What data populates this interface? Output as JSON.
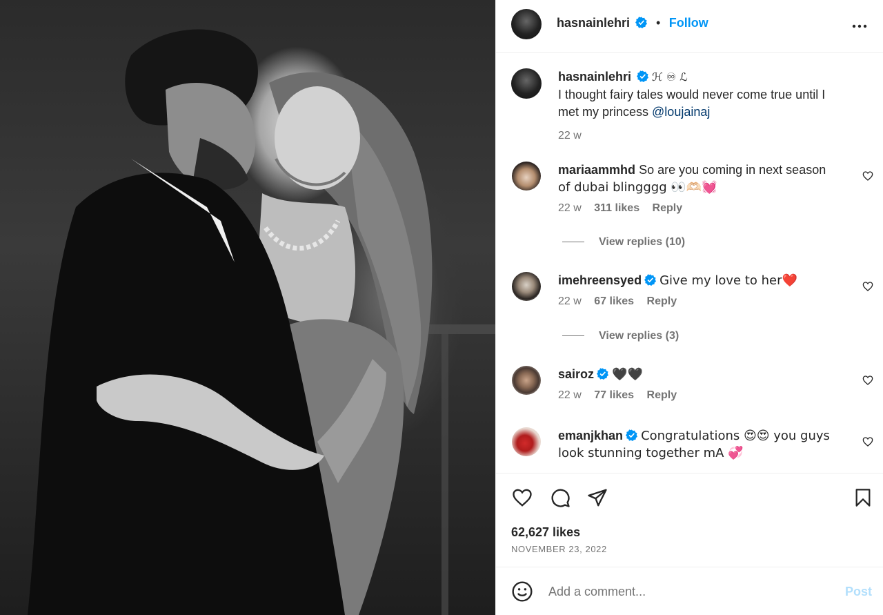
{
  "post": {
    "image_alt": "Black and white photo of a couple embracing"
  },
  "header": {
    "username": "hasnainlehri",
    "separator": "•",
    "follow_label": "Follow",
    "more_icon": "more-horizontal-icon"
  },
  "caption": {
    "username": "hasnainlehri",
    "badge_text": "ℋ ♾ ℒ",
    "text_line1": "I thought fairy tales would never come true until I",
    "text_line2": "met my princess ",
    "mention": "@loujainaj",
    "time": "22 w"
  },
  "comments": [
    {
      "username": "mariaammhd",
      "text_line1": "So are you coming in next season",
      "text_line2": "of dubai blingggg 👀🫶🏻💓",
      "time": "22 w",
      "likes": "311 likes",
      "reply": "Reply",
      "view_replies": "View replies (10)",
      "verified": false
    },
    {
      "username": "imehreensyed",
      "text_line1": "Give my love to her❤️",
      "time": "22 w",
      "likes": "67 likes",
      "reply": "Reply",
      "view_replies": "View replies (3)",
      "verified": true
    },
    {
      "username": "sairoz",
      "text_line1": "🖤🖤",
      "time": "22 w",
      "likes": "77 likes",
      "reply": "Reply",
      "verified": true
    },
    {
      "username": "emanjkhan",
      "text_line1": "Congratulations 😍😍 you guys",
      "text_line2": "look stunning together mA 💞",
      "verified": true
    }
  ],
  "footer": {
    "likes": "62,627 likes",
    "date": "NOVEMBER 23, 2022",
    "comment_placeholder": "Add a comment...",
    "post_label": "Post"
  },
  "colors": {
    "accent": "#0095f6",
    "link": "#00376b",
    "muted": "#737373",
    "post_disabled": "#b2dffc"
  }
}
